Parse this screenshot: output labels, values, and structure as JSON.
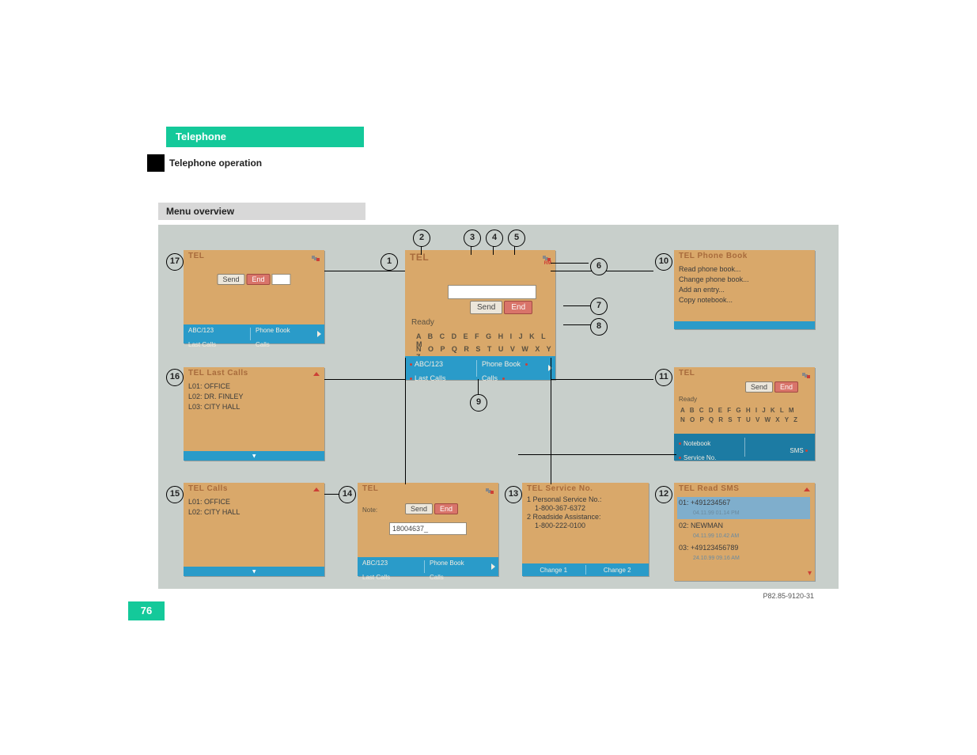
{
  "header": {
    "tab": "Telephone",
    "subtab": "Telephone operation"
  },
  "section": "Menu overview",
  "page_number": "76",
  "figure_code": "P82.85-9120-31",
  "common": {
    "tel": "TEL",
    "send": "Send",
    "end": "End",
    "ready": "Ready",
    "alpha_row1": "A B C D E F G H I J K L M",
    "alpha_row2": "N O P Q R S T U V W X Y Z",
    "abc123": "ABC/123",
    "last_calls": "Last Calls",
    "phone_book": "Phone Book",
    "calls": "Calls",
    "note": "Note:",
    "roam": "RM"
  },
  "callouts": [
    "1",
    "2",
    "3",
    "4",
    "5",
    "6",
    "7",
    "8",
    "9",
    "10",
    "11",
    "12",
    "13",
    "14",
    "15",
    "16",
    "17"
  ],
  "tile17": {
    "title": "TEL"
  },
  "tile1": {
    "title": "TEL"
  },
  "tile10": {
    "title": "TEL Phone Book",
    "items": [
      "Read phone book...",
      "Change phone book...",
      "Add an entry...",
      "Copy notebook..."
    ]
  },
  "tile16": {
    "title": "TEL Last Calls",
    "items": [
      "L01: OFFICE",
      "L02: DR. FINLEY",
      "L03: CITY HALL"
    ]
  },
  "tile11": {
    "title": "TEL",
    "footer_left": "Notebook",
    "footer_right": "SMS",
    "footer_left2": "Service No."
  },
  "tile15": {
    "title": "TEL Calls",
    "items": [
      "L01: OFFICE",
      "L02: CITY HALL"
    ]
  },
  "tile14": {
    "title": "TEL",
    "note_label": "Note:",
    "input_value": "18004637_"
  },
  "tile13": {
    "title": "TEL Service No.",
    "row1_label": "1 Personal Service No.:",
    "row1_num": "1-800-367-6372",
    "row2_label": "2 Roadside Assistance:",
    "row2_num": "1-800-222-0100",
    "footer_left": "Change 1",
    "footer_right": "Change 2"
  },
  "tile12": {
    "title": "TEL Read SMS",
    "rows": [
      {
        "main": "01:  +491234567",
        "sub": "04.11.99  01.14 PM"
      },
      {
        "main": "02:  NEWMAN",
        "sub": "04.11.99  10.42 AM"
      },
      {
        "main": "03:  +49123456789",
        "sub": "24.10.99  09.16 AM"
      }
    ]
  }
}
